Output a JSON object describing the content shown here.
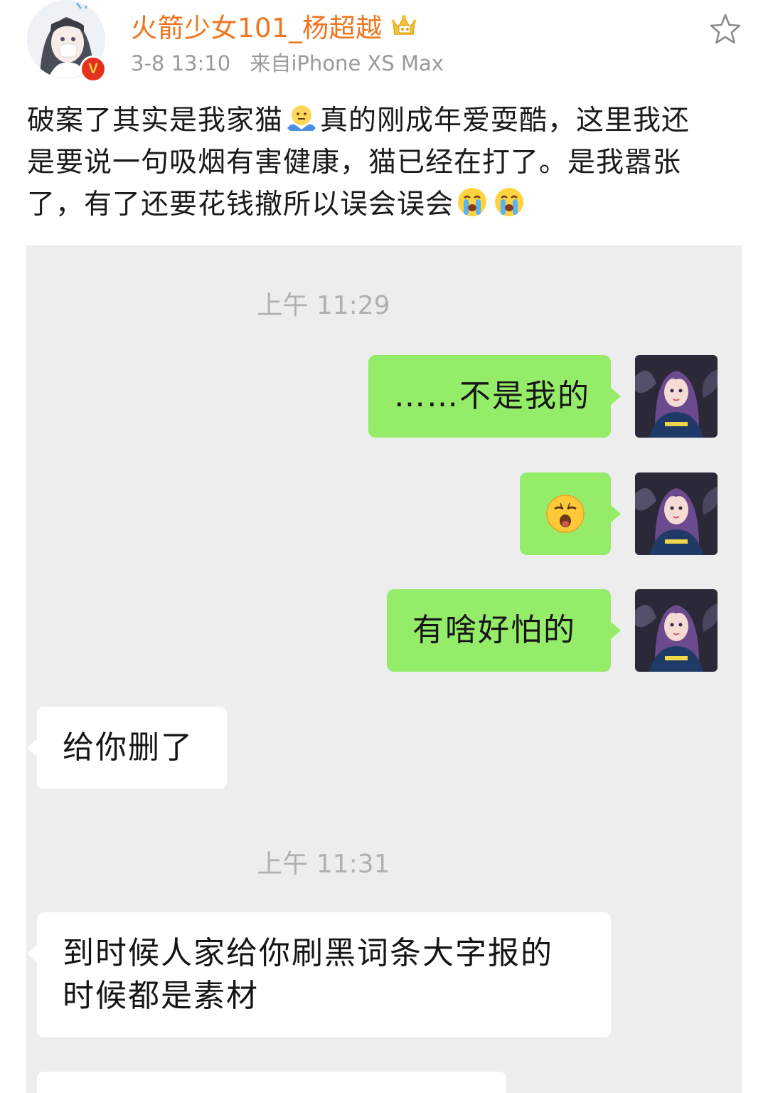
{
  "post": {
    "username": "火箭少女101_杨超越",
    "time": "3-8 13:10",
    "source": "来自iPhone XS Max",
    "icons": {
      "verified": "verified-v-badge",
      "vip": "vip-crown-icon",
      "favorite": "star-icon"
    },
    "text": {
      "line1_a": "破案了其实是我家猫",
      "line1_emoji": "shrug-emoji",
      "line1_b": "真的刚成年爱耍酷，这里我还",
      "line2": "是要说一句吸烟有害健康，猫已经在打了。是我嚣张",
      "line3": "了，有了还要花钱撤所以误会误会",
      "line3_emojis": [
        "crying-emoji",
        "crying-emoji"
      ]
    }
  },
  "chat": {
    "time_1": "上午 11:29",
    "time_2": "上午 11:31",
    "messages": [
      {
        "side": "out",
        "text": "……不是我的"
      },
      {
        "side": "out",
        "emoji": "yawning-emoji"
      },
      {
        "side": "out",
        "text": "有啥好怕的"
      },
      {
        "side": "in",
        "text": "给你删了"
      },
      {
        "side": "in",
        "line1": "到时候人家给你刷黑词条大字报的",
        "line2": "时候都是素材"
      }
    ]
  },
  "colors": {
    "username": "#f0741e",
    "meta": "#9a9a9a",
    "chat_bg": "#ededed",
    "bubble_out": "#95ec69",
    "bubble_in": "#ffffff"
  }
}
